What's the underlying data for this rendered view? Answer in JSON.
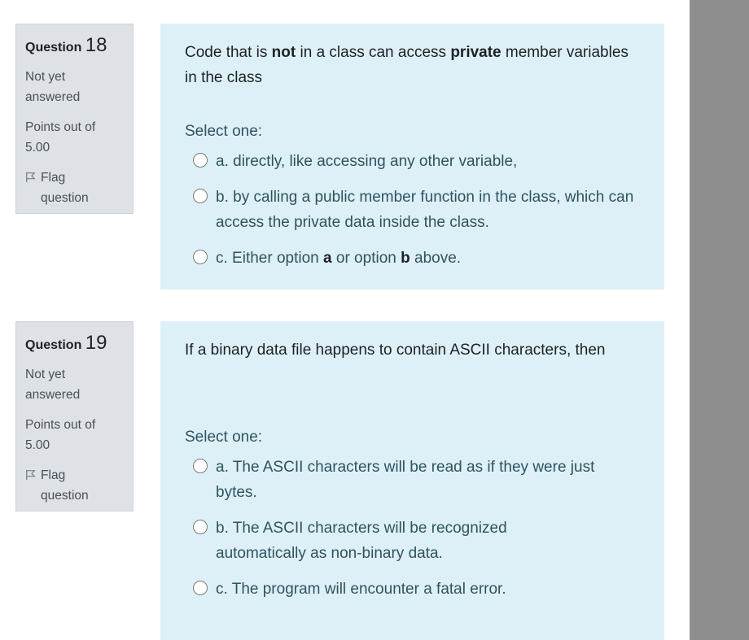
{
  "questions": [
    {
      "label": "Question",
      "number": "18",
      "status": "Not yet answered",
      "points": "Points out of 5.00",
      "flag_label": "Flag question",
      "text_parts": [
        "Code that is ",
        "not",
        " in a class can access ",
        "private",
        " member variables in the class"
      ],
      "prompt": "Select one:",
      "options": [
        {
          "parts": [
            "a. directly, like accessing any other variable,"
          ]
        },
        {
          "parts": [
            "b. by calling a public member function in the class, which can access the private data inside the class."
          ]
        },
        {
          "parts": [
            "c. Either option ",
            "a",
            " or option ",
            "b",
            " above."
          ]
        }
      ]
    },
    {
      "label": "Question",
      "number": "19",
      "status": "Not yet answered",
      "points": "Points out of 5.00",
      "flag_label": "Flag question",
      "text_parts": [
        "If a binary data file happens to contain ASCII characters, then"
      ],
      "prompt": "Select one:",
      "options": [
        {
          "parts": [
            "a. The ASCII characters will be read as if they were just bytes."
          ]
        },
        {
          "parts": [
            "b. The ASCII characters will be recognized automatically as non-binary data."
          ]
        },
        {
          "parts": [
            "c. The program will encounter a fatal error."
          ]
        }
      ]
    }
  ]
}
